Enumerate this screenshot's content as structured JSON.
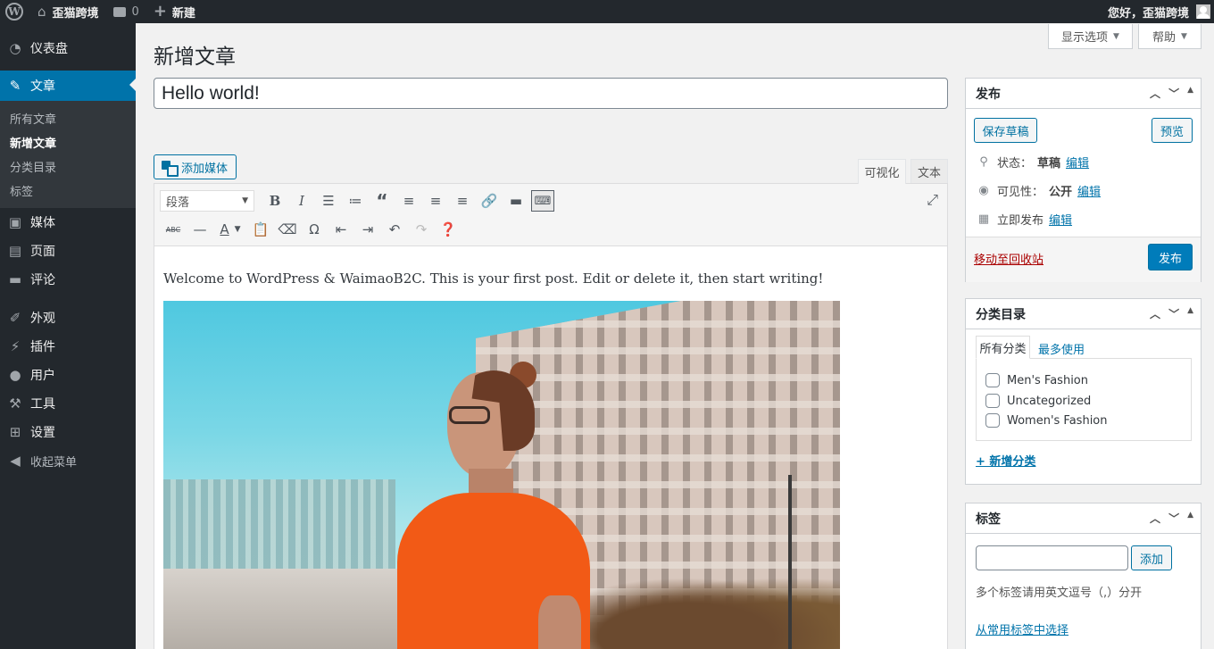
{
  "admin_bar": {
    "site_name": "歪猫跨境",
    "comments_count": "0",
    "new_label": "新建",
    "greeting": "您好，歪猫跨境"
  },
  "sidebar": {
    "items": [
      {
        "label": "仪表盘",
        "icon": "dashboard-icon"
      },
      {
        "label": "文章",
        "icon": "pin-icon",
        "active": true
      },
      {
        "label": "媒体",
        "icon": "media-icon"
      },
      {
        "label": "页面",
        "icon": "page-icon"
      },
      {
        "label": "评论",
        "icon": "comment-icon"
      },
      {
        "label": "外观",
        "icon": "brush-icon"
      },
      {
        "label": "插件",
        "icon": "plugin-icon"
      },
      {
        "label": "用户",
        "icon": "user-icon"
      },
      {
        "label": "工具",
        "icon": "wrench-icon"
      },
      {
        "label": "设置",
        "icon": "settings-icon"
      },
      {
        "label": "收起菜单",
        "icon": "collapse-icon"
      }
    ],
    "submenu": [
      "所有文章",
      "新增文章",
      "分类目录",
      "标签"
    ]
  },
  "screen_options_label": "显示选项",
  "help_label": "帮助",
  "page_title": "新增文章",
  "post_title": "Hello world!",
  "add_media_label": "添加媒体",
  "editor_tabs": {
    "visual": "可视化",
    "text": "文本"
  },
  "format_select": "段落",
  "content_text": "Welcome to WordPress & WaimaoB2C. This is your first post. Edit or delete it, then start writing!",
  "publish_box": {
    "title": "发布",
    "save_draft": "保存草稿",
    "preview": "预览",
    "status_label": "状态：",
    "status_value": "草稿",
    "visibility_label": "可见性：",
    "visibility_value": "公开",
    "schedule_label": "立即发布",
    "edit_link": "编辑",
    "trash_link": "移动至回收站",
    "publish_button": "发布"
  },
  "categories_box": {
    "title": "分类目录",
    "tab_all": "所有分类",
    "tab_popular": "最多使用",
    "items": [
      "Men's Fashion",
      "Uncategorized",
      "Women's Fashion"
    ],
    "add_new": "+ 新增分类"
  },
  "tags_box": {
    "title": "标签",
    "add_button": "添加",
    "help": "多个标签请用英文逗号（,）分开",
    "choose_link": "从常用标签中选择"
  },
  "colors": {
    "admin_bar": "#23282d",
    "sidebar_active": "#0073aa",
    "primary_button": "#007cba",
    "trash_link": "#a00"
  }
}
